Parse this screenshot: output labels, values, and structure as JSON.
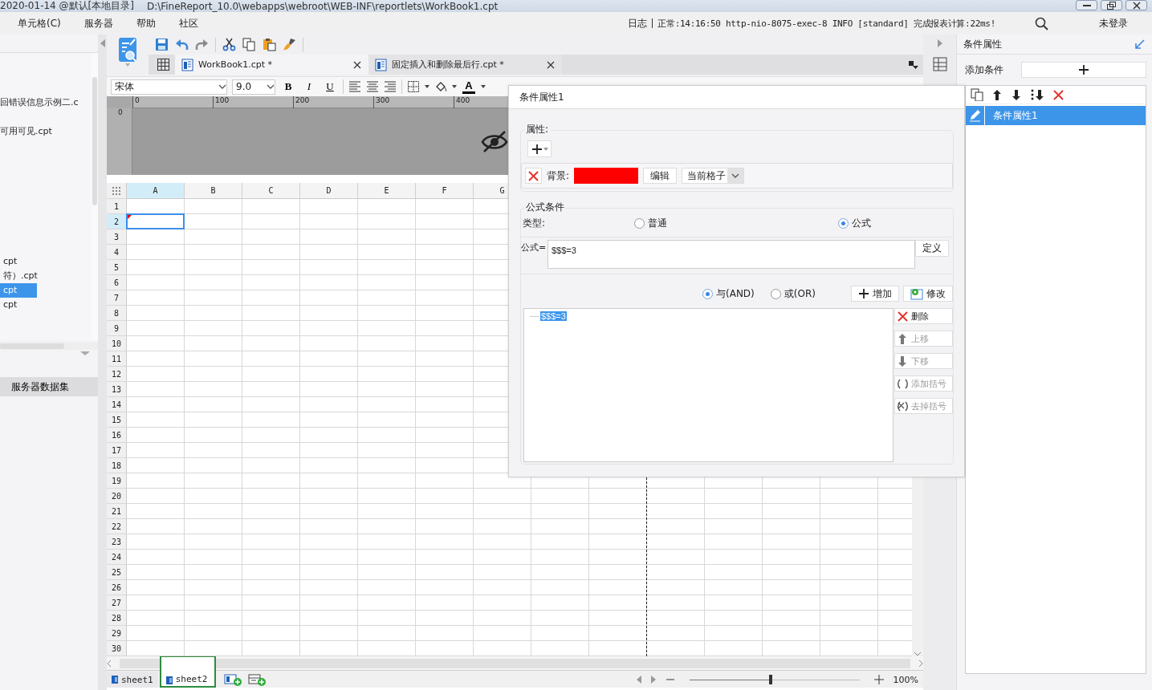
{
  "title_bar": {
    "title": "2020-01-14 @默认[本地目录]",
    "path": "D:\\FineReport_10.0\\webapps\\webroot\\WEB-INF\\reportlets\\WorkBook1.cpt"
  },
  "menu": [
    {
      "label": "单元格(C)"
    },
    {
      "label": "服务器"
    },
    {
      "label": "帮助"
    },
    {
      "label": "社区"
    }
  ],
  "status": {
    "log_label": "日志",
    "message": "正常:14:16:50 http-nio-8075-exec-8 INFO [standard] 完成报表计算:22ms!",
    "login": "未登录"
  },
  "file_tree": {
    "group_1": [
      {
        "name": "回错误信息示例二.c",
        "selected": false
      },
      {
        "name": "可用可见.cpt",
        "selected": false
      }
    ],
    "group_2": [
      {
        "name": "cpt",
        "selected": false
      },
      {
        "name": "符）.cpt",
        "selected": false
      },
      {
        "name": "cpt",
        "selected": true
      },
      {
        "name": "cpt",
        "selected": false
      }
    ]
  },
  "dataset_button": "服务器数据集",
  "tabs": [
    {
      "label": "WorkBook1.cpt *",
      "selected": true
    },
    {
      "label": "固定插入和删除最后行.cpt *",
      "selected": false
    }
  ],
  "format_bar": {
    "font": "宋体",
    "size": "9.0",
    "bold": "B",
    "italic": "I",
    "underline": "U",
    "font_color": "A"
  },
  "ruler": {
    "marks": [
      "0",
      "100",
      "200",
      "300",
      "400"
    ],
    "vertical_mark": "0"
  },
  "sheet": {
    "columns": [
      {
        "label": "A",
        "selected": true
      },
      {
        "label": "B",
        "selected": false
      },
      {
        "label": "C",
        "selected": false
      },
      {
        "label": "D",
        "selected": false
      },
      {
        "label": "E",
        "selected": false
      },
      {
        "label": "F",
        "selected": false
      },
      {
        "label": "G",
        "selected": false
      }
    ],
    "rows": [
      {
        "label": "1",
        "selected": false
      },
      {
        "label": "2",
        "selected": true
      },
      {
        "label": "3",
        "selected": false
      },
      {
        "label": "4",
        "selected": false
      },
      {
        "label": "5",
        "selected": false
      },
      {
        "label": "6",
        "selected": false
      },
      {
        "label": "7",
        "selected": false
      },
      {
        "label": "8",
        "selected": false
      },
      {
        "label": "9",
        "selected": false
      },
      {
        "label": "10",
        "selected": false
      },
      {
        "label": "11",
        "selected": false
      },
      {
        "label": "12",
        "selected": false
      },
      {
        "label": "13",
        "selected": false
      },
      {
        "label": "14",
        "selected": false
      },
      {
        "label": "15",
        "selected": false
      },
      {
        "label": "16",
        "selected": false
      },
      {
        "label": "17",
        "selected": false
      },
      {
        "label": "18",
        "selected": false
      },
      {
        "label": "19",
        "selected": false
      },
      {
        "label": "20",
        "selected": false
      },
      {
        "label": "21",
        "selected": false
      },
      {
        "label": "22",
        "selected": false
      },
      {
        "label": "23",
        "selected": false
      },
      {
        "label": "24",
        "selected": false
      },
      {
        "label": "25",
        "selected": false
      },
      {
        "label": "26",
        "selected": false
      },
      {
        "label": "27",
        "selected": false
      },
      {
        "label": "28",
        "selected": false
      },
      {
        "label": "29",
        "selected": false
      },
      {
        "label": "30",
        "selected": false
      }
    ]
  },
  "sheet_tabs": [
    {
      "label": "sheet1",
      "selected": false
    },
    {
      "label": "sheet2",
      "selected": true
    }
  ],
  "zoom": {
    "level": 0.48,
    "reading": "100%"
  },
  "right_panel": {
    "title": "条件属性",
    "add_label": "添加条件",
    "items": [
      {
        "label": "条件属性1",
        "selected": true
      }
    ]
  },
  "dialog": {
    "title": "条件属性1",
    "properties_label": "属性:",
    "property_rows": [
      {
        "label": "背景:",
        "color": "#ff0000",
        "edit_button": "编辑",
        "scope": "当前格子"
      }
    ],
    "condition_label": "公式条件",
    "type_label": "类型:",
    "types": [
      {
        "label": "普通",
        "selected": false
      },
      {
        "label": "公式",
        "selected": true
      }
    ],
    "formula_label": "公式=",
    "formula": "$$$=3",
    "define_button": "定义",
    "joins": [
      {
        "label": "与(AND)",
        "selected": true
      },
      {
        "label": "或(OR)",
        "selected": false
      }
    ],
    "add_button": "增加",
    "modify_button": "修改",
    "conditions": [
      {
        "text": "$$$=3",
        "selected": true
      }
    ],
    "actions": [
      {
        "label": "删除",
        "kind": "delete",
        "disabled": false
      },
      {
        "label": "上移",
        "kind": "up",
        "disabled": true
      },
      {
        "label": "下移",
        "kind": "down",
        "disabled": true
      },
      {
        "label": "添加括号",
        "kind": "bracket",
        "disabled": true
      },
      {
        "label": "去掉括号",
        "kind": "unbracket",
        "disabled": true
      }
    ]
  }
}
